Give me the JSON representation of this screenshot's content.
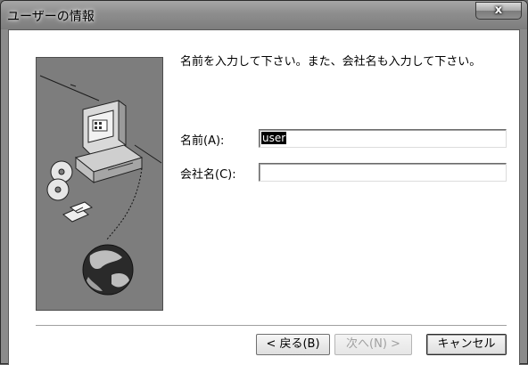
{
  "window": {
    "title": "ユーザーの情報",
    "close_label": "x"
  },
  "instruction": "名前を入力して下さい。また、会社名も入力して下さい。",
  "fields": {
    "name": {
      "label": "名前(A):",
      "mnemonic": "A",
      "value": "user"
    },
    "company": {
      "label": "会社名(C):",
      "mnemonic": "C",
      "value": ""
    }
  },
  "buttons": {
    "back": "< 戻る(B)",
    "next": "次へ(N) >",
    "cancel": "キャンセル"
  },
  "icons": [
    "computer-icon",
    "cd-disc-icon",
    "floppy-disk-icon",
    "globe-icon"
  ]
}
